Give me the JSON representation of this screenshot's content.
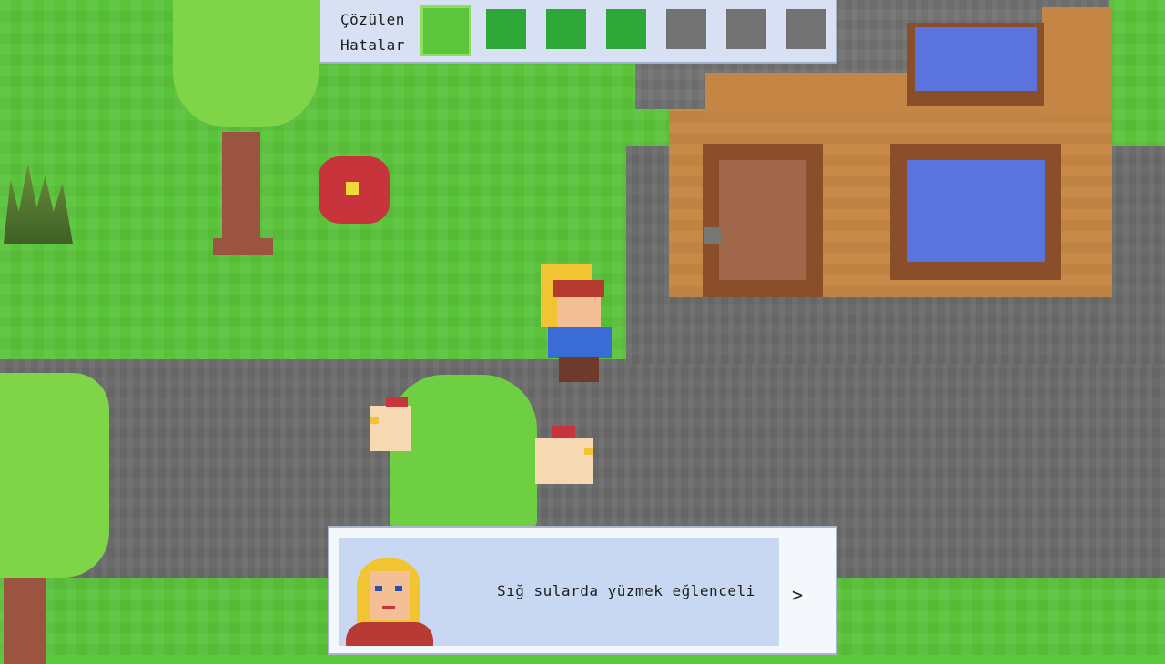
{
  "hud": {
    "label_line1": "Çözülen",
    "label_line2": "Hatalar",
    "slots": [
      {
        "state": "active"
      },
      {
        "state": "solved"
      },
      {
        "state": "solved"
      },
      {
        "state": "solved"
      },
      {
        "state": "empty"
      },
      {
        "state": "empty"
      },
      {
        "state": "empty"
      }
    ]
  },
  "dialog": {
    "text": "Sığ sularda yüzmek eğlenceli",
    "next_label": ">",
    "speaker_icon": "blonde-woman-portrait"
  },
  "colors": {
    "grass": "#59c43a",
    "road": "#6b6b6b",
    "house_wall": "#c88a4a",
    "house_trim": "#8a4f2a",
    "window": "#5b73dc",
    "dialog_panel": "#c9d8f2"
  }
}
